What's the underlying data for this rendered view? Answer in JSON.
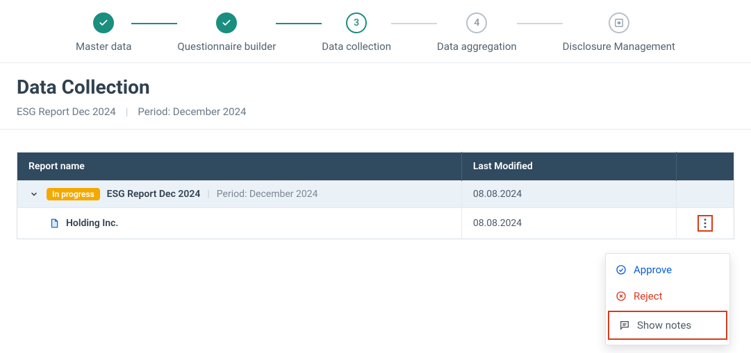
{
  "stepper": {
    "steps": [
      {
        "label": "Master data",
        "state": "done"
      },
      {
        "label": "Questionnaire builder",
        "state": "done"
      },
      {
        "label": "Data collection",
        "state": "current",
        "number": "3"
      },
      {
        "label": "Data aggregation",
        "state": "future",
        "number": "4"
      },
      {
        "label": "Disclosure Management",
        "state": "future",
        "icon": "asterisk"
      }
    ]
  },
  "header": {
    "title": "Data Collection",
    "report": "ESG Report Dec 2024",
    "period_label": "Period: December 2024"
  },
  "table": {
    "columns": {
      "name": "Report name",
      "modified": "Last Modified"
    },
    "group_row": {
      "status_badge": "In progress",
      "name": "ESG Report Dec 2024",
      "period": "Period: December 2024",
      "modified": "08.08.2024"
    },
    "child_row": {
      "name": "Holding Inc.",
      "modified": "08.08.2024"
    }
  },
  "menu": {
    "approve": "Approve",
    "reject": "Reject",
    "show_notes": "Show notes"
  }
}
